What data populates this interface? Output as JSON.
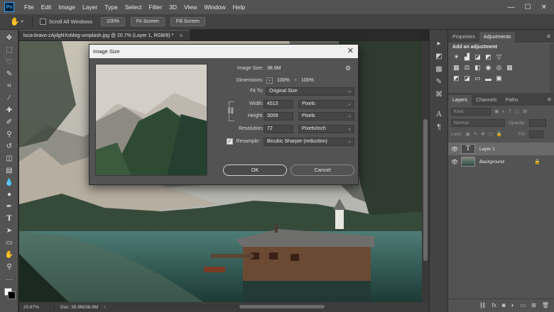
{
  "app": {
    "logo": "Ps"
  },
  "menu": [
    "File",
    "Edit",
    "Image",
    "Layer",
    "Type",
    "Select",
    "Filter",
    "3D",
    "View",
    "Window",
    "Help"
  ],
  "window_controls": {
    "minimize": "—",
    "maximize": "☐",
    "close": "✕"
  },
  "options_bar": {
    "scroll_all_label": "Scroll All Windows",
    "zoom_100_label": "100%",
    "fit_screen_label": "Fit Screen",
    "fill_screen_label": "Fill Screen"
  },
  "document": {
    "tab_title": "luca-bravo-zAjdgNXsMeg-unsplash.jpg @ 20.7% (Layer 1, RGB/8) *",
    "tab_close": "×",
    "zoom": "20.67%",
    "doc_size": "Doc: 38.9M/38.9M"
  },
  "dialog": {
    "title": "Image Size",
    "close": "✕",
    "image_size_label": "Image Size:",
    "image_size_value": "38.9M",
    "dimensions_label": "Dimensions:",
    "dimensions_w": "100%",
    "dimensions_x": "×",
    "dimensions_h": "100%",
    "fit_to_label": "Fit To:",
    "fit_to_value": "Original Size",
    "width_label": "Width:",
    "width_value": "4513",
    "width_unit": "Pixels",
    "height_label": "Height:",
    "height_value": "3009",
    "height_unit": "Pixels",
    "resolution_label": "Resolution:",
    "resolution_value": "72",
    "resolution_unit": "Pixels/Inch",
    "resample_label": "Resample:",
    "resample_checked": true,
    "resample_value": "Bicubic Sharper (reduction)",
    "ok_label": "OK",
    "cancel_label": "Cancel"
  },
  "panels": {
    "top_tabs": [
      "Properties",
      "Adjustments"
    ],
    "active_top_tab": "Adjustments",
    "adjust_title": "Add an adjustment",
    "layer_tabs": [
      "Layers",
      "Channels",
      "Paths"
    ],
    "kind_placeholder": "Kind",
    "blend_mode": "Normal",
    "opacity_label": "Opacity:",
    "lock_label": "Lock:",
    "fill_label": "Fill:",
    "layers": [
      {
        "name": "Layer 1",
        "selected": true,
        "thumb": "T"
      },
      {
        "name": "Background",
        "selected": false,
        "locked": true
      }
    ]
  }
}
